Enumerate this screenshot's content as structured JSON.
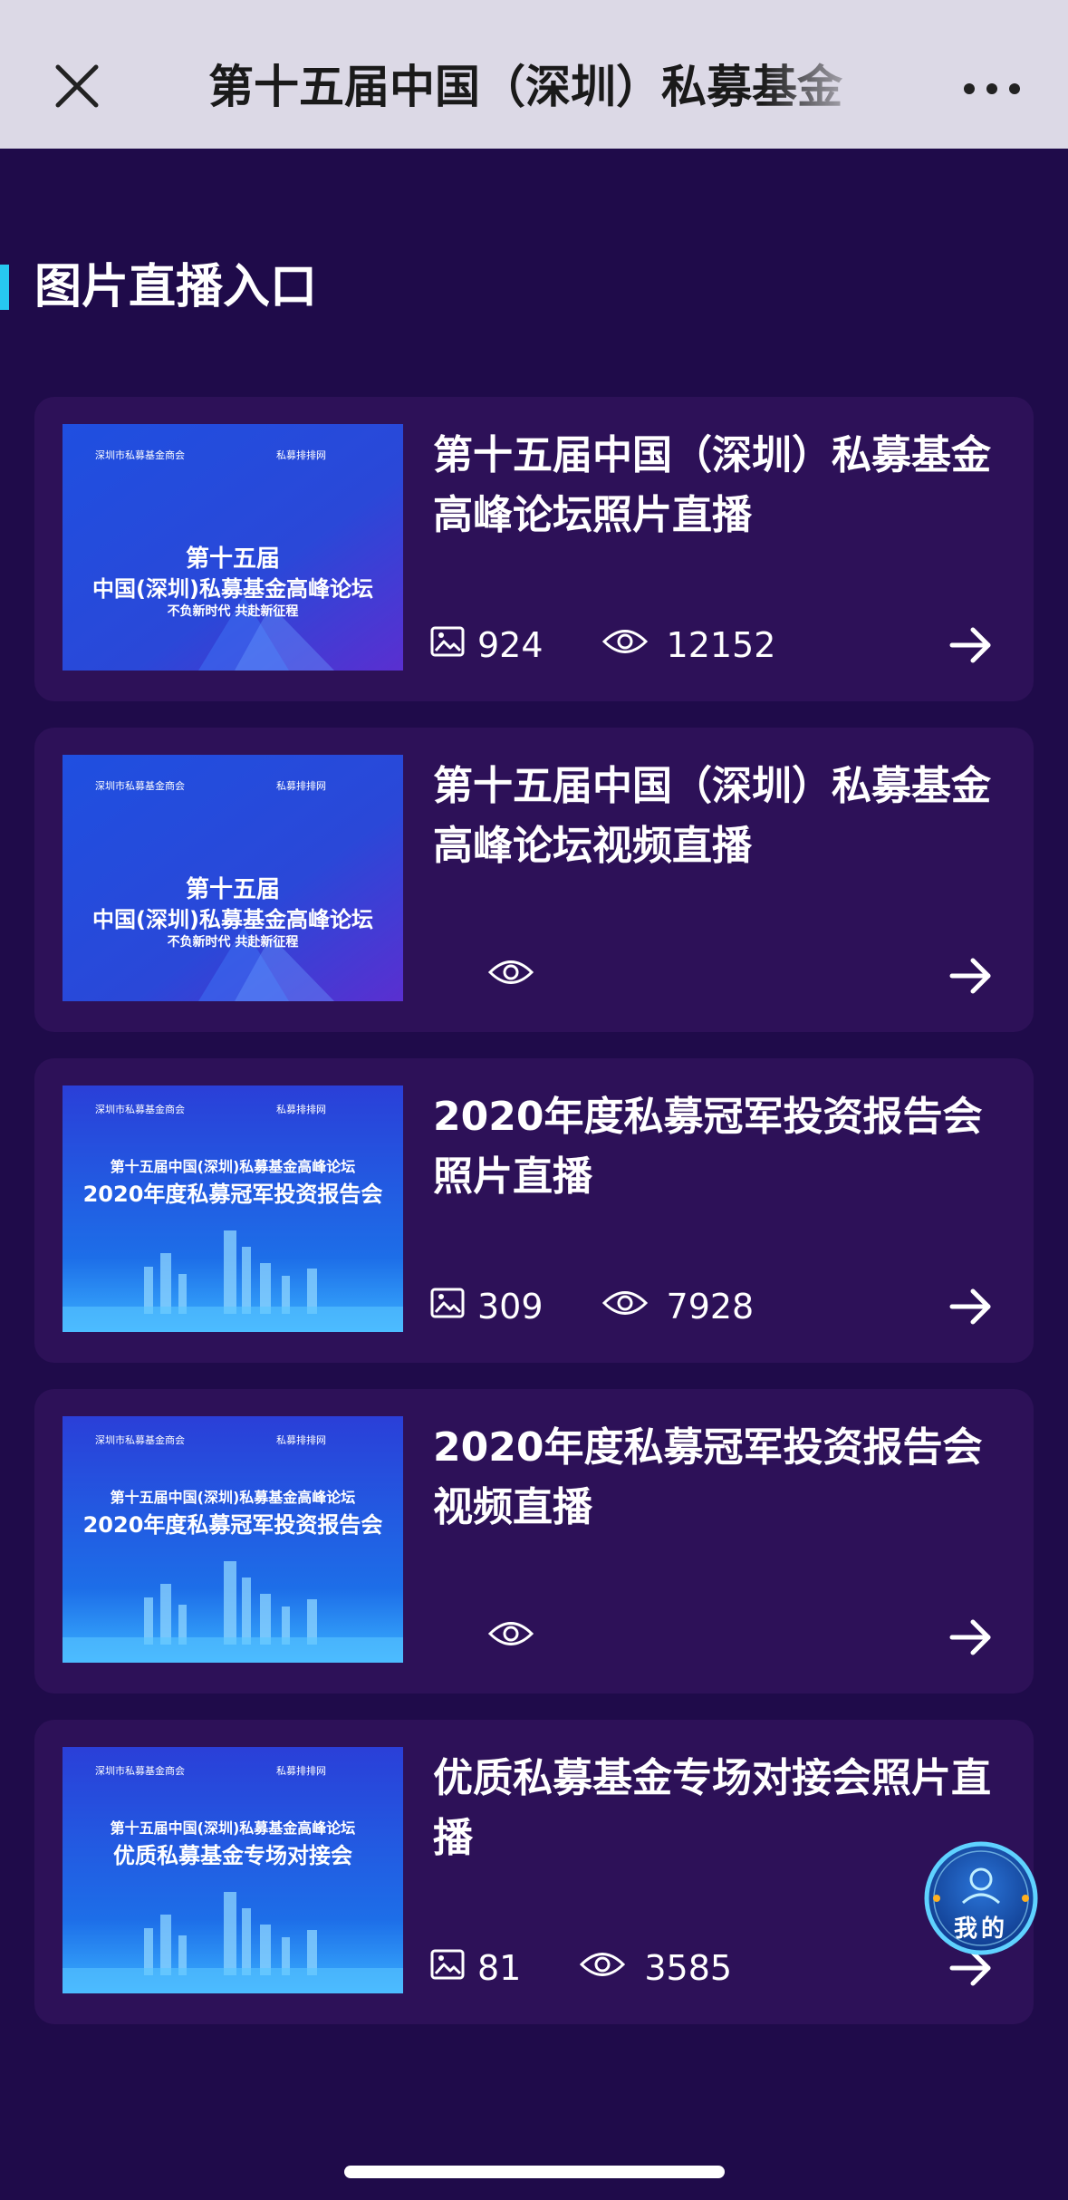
{
  "header": {
    "title": "第十五届中国（深圳）私募基金",
    "close_icon": "close-icon",
    "more_icon": "more-dots-icon"
  },
  "section": {
    "title": "图片直播入口",
    "accent_color": "#27c8f0"
  },
  "cards": [
    {
      "title": "第十五届中国（深圳）私募基金高峰论坛照片直播",
      "photos": "924",
      "views": "12152",
      "thumb": {
        "org": "深圳市私募基金商会",
        "partner": "私募排排网",
        "line1": "第十五届",
        "line2": "中国(深圳)私募基金高峰论坛",
        "slogan": "不负新时代  共赴新征程"
      }
    },
    {
      "title": "第十五届中国（深圳）私募基金高峰论坛视频直播",
      "photos": "",
      "views": "",
      "thumb": {
        "org": "深圳市私募基金商会",
        "partner": "私募排排网",
        "line1": "第十五届",
        "line2": "中国(深圳)私募基金高峰论坛",
        "slogan": "不负新时代  共赴新征程"
      }
    },
    {
      "title": "2020年度私募冠军投资报告会照片直播",
      "photos": "309",
      "views": "7928",
      "thumb": {
        "org": "深圳市私募基金商会",
        "partner": "私募排排网",
        "line1": "第十五届中国(深圳)私募基金高峰论坛",
        "line2": "2020年度私募冠军投资报告会"
      }
    },
    {
      "title": "2020年度私募冠军投资报告会视频直播",
      "photos": "",
      "views": "",
      "thumb": {
        "org": "深圳市私募基金商会",
        "partner": "私募排排网",
        "line1": "第十五届中国(深圳)私募基金高峰论坛",
        "line2": "2020年度私募冠军投资报告会"
      }
    },
    {
      "title": "优质私募基金专场对接会照片直播",
      "photos": "81",
      "views": "3585",
      "thumb": {
        "org": "深圳市私募基金商会",
        "partner": "私募排排网",
        "line1": "第十五届中国(深圳)私募基金高峰论坛",
        "line2": "优质私募基金专场对接会"
      }
    }
  ],
  "fab": {
    "label": "我的",
    "icon": "user-avatar-icon"
  },
  "icons": {
    "photo": "image-icon",
    "views": "eye-icon",
    "go": "arrow-right-icon"
  }
}
